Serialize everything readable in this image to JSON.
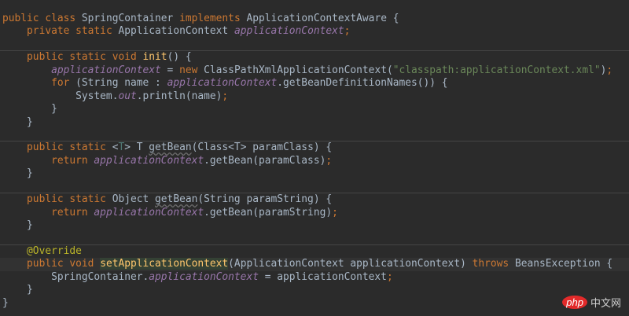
{
  "colors": {
    "background": "#2b2b2b",
    "keyword": "#cc7832",
    "field": "#9876aa",
    "string": "#6a8759",
    "annotation": "#bbb529",
    "method_decl": "#ffc66d",
    "text": "#a9b7c6"
  },
  "lines": [
    {
      "tokens": [
        {
          "t": "public class ",
          "c": "kw"
        },
        {
          "t": "SpringContainer "
        },
        {
          "t": "implements ",
          "c": "kw"
        },
        {
          "t": "ApplicationContextAware {"
        }
      ]
    },
    {
      "tokens": [
        {
          "t": "    "
        },
        {
          "t": "private static ",
          "c": "kw"
        },
        {
          "t": "ApplicationContext "
        },
        {
          "t": "applicationContext",
          "c": "field"
        },
        {
          "t": ";",
          "c": "kw"
        }
      ]
    },
    {
      "tokens": []
    },
    {
      "sep": true,
      "tokens": [
        {
          "t": "    "
        },
        {
          "t": "public static void ",
          "c": "kw"
        },
        {
          "t": "init",
          "c": "decl"
        },
        {
          "t": "() {"
        }
      ]
    },
    {
      "tokens": [
        {
          "t": "        "
        },
        {
          "t": "applicationContext",
          "c": "field"
        },
        {
          "t": " = "
        },
        {
          "t": "new ",
          "c": "kw"
        },
        {
          "t": "ClassPathXmlApplicationContext("
        },
        {
          "t": "\"classpath:applicationContext.xml\"",
          "c": "str"
        },
        {
          "t": ")"
        },
        {
          "t": ";",
          "c": "kw"
        }
      ]
    },
    {
      "tokens": [
        {
          "t": "        "
        },
        {
          "t": "for ",
          "c": "kw"
        },
        {
          "t": "(String name : "
        },
        {
          "t": "applicationContext",
          "c": "field"
        },
        {
          "t": ".getBeanDefinitionNames()) {"
        }
      ]
    },
    {
      "tokens": [
        {
          "t": "            System."
        },
        {
          "t": "out",
          "c": "field"
        },
        {
          "t": ".println(name)"
        },
        {
          "t": ";",
          "c": "kw"
        }
      ]
    },
    {
      "tokens": [
        {
          "t": "        }"
        }
      ]
    },
    {
      "tokens": [
        {
          "t": "    }"
        }
      ]
    },
    {
      "tokens": []
    },
    {
      "sep": true,
      "tokens": [
        {
          "t": "    "
        },
        {
          "t": "public static ",
          "c": "kw"
        },
        {
          "t": "<"
        },
        {
          "t": "T",
          "c": "tp"
        },
        {
          "t": "> T "
        },
        {
          "t": "getBean",
          "c": "unused"
        },
        {
          "t": "(Class<T> paramClass) {"
        }
      ]
    },
    {
      "tokens": [
        {
          "t": "        "
        },
        {
          "t": "return ",
          "c": "kw"
        },
        {
          "t": "applicationContext",
          "c": "field"
        },
        {
          "t": ".getBean(paramClass)"
        },
        {
          "t": ";",
          "c": "kw"
        }
      ]
    },
    {
      "tokens": [
        {
          "t": "    }"
        }
      ]
    },
    {
      "tokens": []
    },
    {
      "sep": true,
      "tokens": [
        {
          "t": "    "
        },
        {
          "t": "public static ",
          "c": "kw"
        },
        {
          "t": "Object "
        },
        {
          "t": "getBean",
          "c": "unused"
        },
        {
          "t": "(String paramString) {"
        }
      ]
    },
    {
      "tokens": [
        {
          "t": "        "
        },
        {
          "t": "return ",
          "c": "kw"
        },
        {
          "t": "applicationContext",
          "c": "field"
        },
        {
          "t": ".getBean(paramString)"
        },
        {
          "t": ";",
          "c": "kw"
        }
      ]
    },
    {
      "tokens": [
        {
          "t": "    }"
        }
      ]
    },
    {
      "tokens": []
    },
    {
      "sep": true,
      "tokens": [
        {
          "t": "    "
        },
        {
          "t": "@Override",
          "c": "ann"
        }
      ]
    },
    {
      "current": true,
      "tokens": [
        {
          "t": "    "
        },
        {
          "t": "public void ",
          "c": "kw"
        },
        {
          "t": "setApplica",
          "c": "hl"
        },
        {
          "caret": true
        },
        {
          "t": "tionContext",
          "c": "hl"
        },
        {
          "t": "(ApplicationContext applicationContext) "
        },
        {
          "t": "throws ",
          "c": "kw"
        },
        {
          "t": "BeansException {"
        }
      ]
    },
    {
      "tokens": [
        {
          "t": "        SpringContainer."
        },
        {
          "t": "applicationContext",
          "c": "field"
        },
        {
          "t": " = applicationContext"
        },
        {
          "t": ";",
          "c": "kw"
        }
      ]
    },
    {
      "tokens": [
        {
          "t": "    }"
        }
      ]
    },
    {
      "tokens": [
        {
          "t": "}"
        }
      ]
    }
  ],
  "watermark": {
    "logo": "php",
    "text": "中文网"
  }
}
